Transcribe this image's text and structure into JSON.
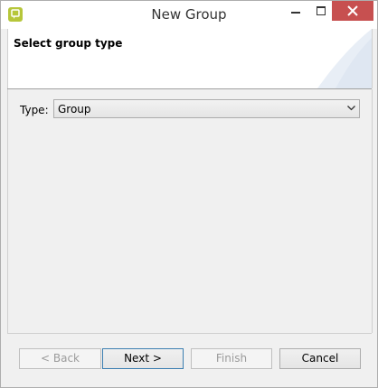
{
  "window": {
    "title": "New Group"
  },
  "banner": {
    "title": "Select group type"
  },
  "form": {
    "type_label": "Type:",
    "type_value": "Group"
  },
  "buttons": {
    "back": "< Back",
    "next": "Next >",
    "finish": "Finish",
    "cancel": "Cancel"
  },
  "icons": {
    "app": "app-icon",
    "minimize": "minimize-icon",
    "maximize": "maximize-icon",
    "close": "close-icon",
    "dropdown": "chevron-down-icon"
  },
  "colors": {
    "close_button": "#c75050",
    "app_icon": "#b6c63a",
    "default_button_border": "#3c7fb1"
  }
}
